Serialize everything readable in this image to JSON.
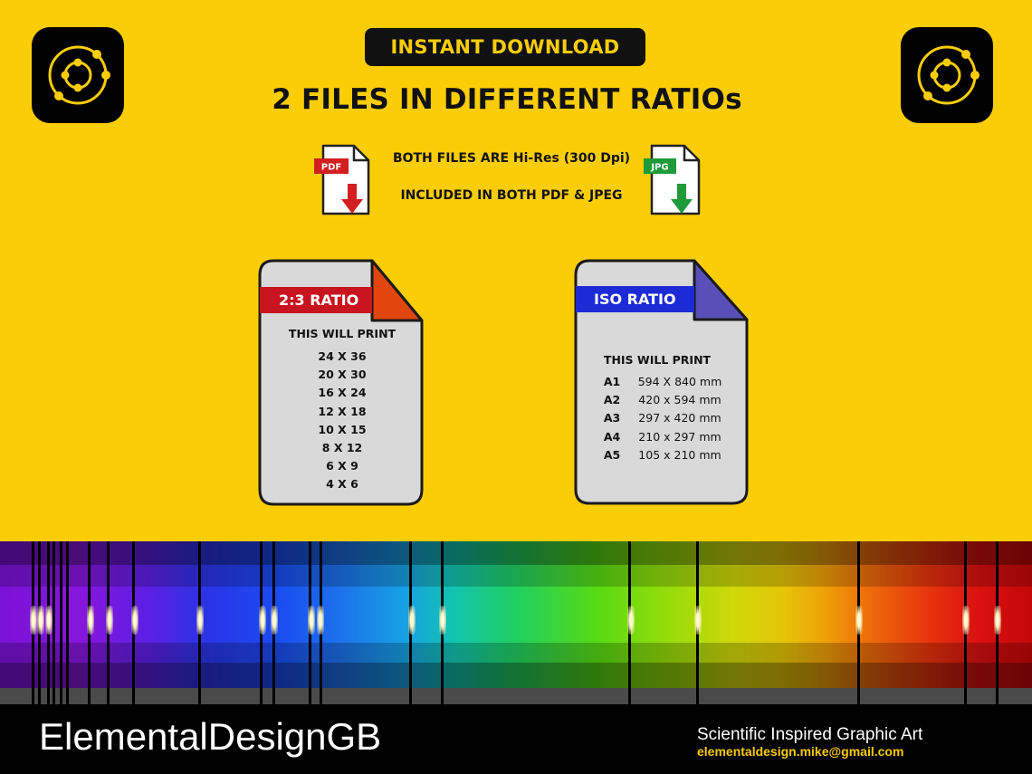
{
  "header": {
    "badge": "INSTANT DOWNLOAD",
    "title": "2 FILES IN DIFFERENT RATIOs"
  },
  "logos": {
    "icon": "atom-orbit-logo",
    "color": "#fbcd06"
  },
  "file_info": {
    "line1": "BOTH FILES ARE Hi-Res (300 Dpi)",
    "line2": "INCLUDED IN BOTH PDF & JPEG",
    "pdf_label": "PDF",
    "jpg_label": "JPG",
    "pdf_color": "#d21f1f",
    "jpg_color": "#1f9a3a"
  },
  "cards": {
    "ratio_2_3": {
      "tag": "2:3 RATIO",
      "tag_color": "#c8141e",
      "fold_color": "#e0460e",
      "subtitle": "THIS WILL PRINT",
      "sizes": [
        "24 X 36",
        "20 X 30",
        "16 X 24",
        "12 X 18",
        "10 X 15",
        "8 X 12",
        "6 X 9",
        "4 X 6"
      ]
    },
    "iso": {
      "tag": "ISO RATIO",
      "tag_color": "#1c2bd6",
      "fold_color": "#5a4fb8",
      "subtitle": "THIS WILL PRINT",
      "sizes": [
        {
          "code": "A1",
          "dim": "594 X 840 mm"
        },
        {
          "code": "A2",
          "dim": "420 x 594 mm"
        },
        {
          "code": "A3",
          "dim": "297 x 420 mm"
        },
        {
          "code": "A4",
          "dim": "210 x 297 mm"
        },
        {
          "code": "A5",
          "dim": "105 x 210 mm"
        }
      ]
    }
  },
  "footer": {
    "brand": "ElementalDesignGB",
    "tagline": "Scientific Inspired Graphic Art",
    "email": "elementaldesign.mike@gmail.com"
  }
}
